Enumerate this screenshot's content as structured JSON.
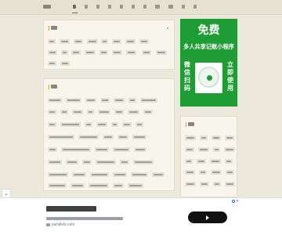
{
  "promo": {
    "headline": "免费",
    "subtitle": "多人共享记账小程序",
    "side_left": [
      "微",
      "信",
      "扫",
      "码"
    ],
    "side_right": [
      "立",
      "即",
      "使",
      "用"
    ]
  },
  "bottom_ad": {
    "domain": "parallels.com",
    "collapse_icon": "chevron-down",
    "cta_icon": "arrow-right"
  },
  "colors": {
    "promo_green": "#1f9d35",
    "accent_gold": "#c9a546",
    "cta_black": "#111111",
    "ad_blue": "#1a73e8"
  }
}
